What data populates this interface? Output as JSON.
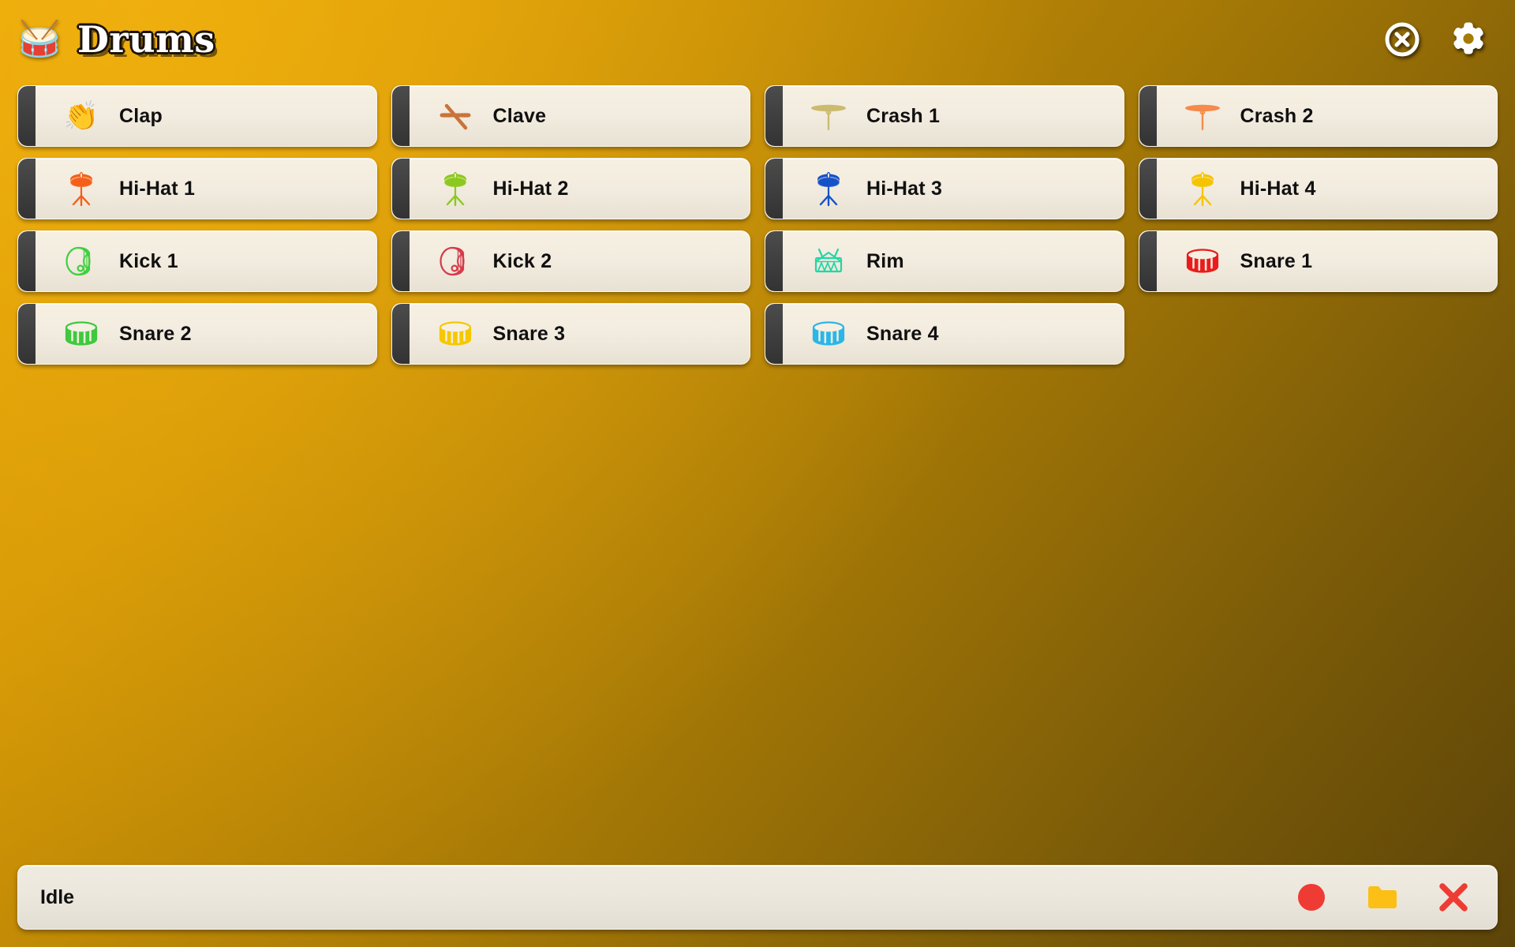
{
  "header": {
    "app_icon": "drum-icon",
    "app_icon_glyph": "🥁",
    "title": "Drums",
    "actions": [
      {
        "name": "close-button",
        "icon": "close-circle-icon"
      },
      {
        "name": "settings-button",
        "icon": "gear-icon"
      }
    ]
  },
  "pads": [
    {
      "label": "Clap",
      "icon": "clap-hands-icon",
      "kind": "emoji",
      "glyph": "👏",
      "color": "#c9a0b4"
    },
    {
      "label": "Clave",
      "icon": "clave-sticks-icon",
      "kind": "clave",
      "color": "#c9743a"
    },
    {
      "label": "Crash 1",
      "icon": "crash-cymbal-icon",
      "kind": "cymbal",
      "color": "#cbbb6e"
    },
    {
      "label": "Crash 2",
      "icon": "crash-cymbal-icon",
      "kind": "cymbal",
      "color": "#f58a4b"
    },
    {
      "label": "Hi-Hat 1",
      "icon": "hi-hat-icon",
      "kind": "hihat",
      "color": "#f4601a"
    },
    {
      "label": "Hi-Hat 2",
      "icon": "hi-hat-icon",
      "kind": "hihat",
      "color": "#8bc91e"
    },
    {
      "label": "Hi-Hat 3",
      "icon": "hi-hat-icon",
      "kind": "hihat",
      "color": "#1552c8"
    },
    {
      "label": "Hi-Hat 4",
      "icon": "hi-hat-icon",
      "kind": "hihat",
      "color": "#f5c400"
    },
    {
      "label": "Kick 1",
      "icon": "kick-drum-icon",
      "kind": "kick",
      "color": "#3fcf3f"
    },
    {
      "label": "Kick 2",
      "icon": "kick-drum-icon",
      "kind": "kick",
      "color": "#d63a4a"
    },
    {
      "label": "Rim",
      "icon": "rim-shot-icon",
      "kind": "rim",
      "color": "#21d6a6"
    },
    {
      "label": "Snare 1",
      "icon": "snare-drum-icon",
      "kind": "snare",
      "color": "#e81c1c"
    },
    {
      "label": "Snare 2",
      "icon": "snare-drum-icon",
      "kind": "snare",
      "color": "#3ec93e"
    },
    {
      "label": "Snare 3",
      "icon": "snare-drum-icon",
      "kind": "snare",
      "color": "#f5c800"
    },
    {
      "label": "Snare 4",
      "icon": "snare-drum-icon",
      "kind": "snare",
      "color": "#2ab6e8"
    }
  ],
  "status": {
    "text": "Idle",
    "actions": [
      {
        "name": "record-button",
        "icon": "record-circle-icon",
        "color": "#ee3b33"
      },
      {
        "name": "open-folder-button",
        "icon": "folder-icon",
        "color": "#fbbf16"
      },
      {
        "name": "clear-button",
        "icon": "close-x-icon",
        "color": "#ee3b33"
      }
    ]
  },
  "colors": {
    "background_top": "#e0a006",
    "background_bottom": "#5c4409",
    "pad_body": "#f3ece0",
    "pad_tab": "#3f3f3f",
    "text": "#101010"
  }
}
